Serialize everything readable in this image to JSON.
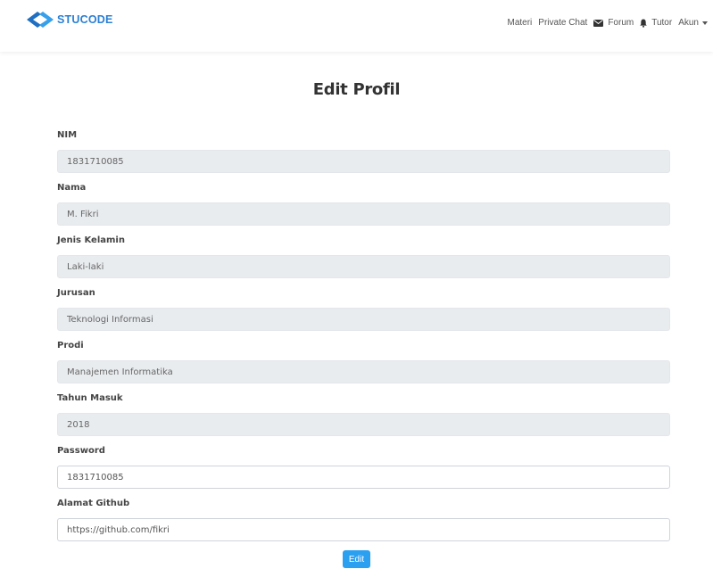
{
  "brand": {
    "name": "STUCODE",
    "color": "#2a7fd4",
    "icon": "code-brackets-icon"
  },
  "nav": {
    "items": [
      {
        "label": "Materi"
      },
      {
        "label": "Private Chat"
      },
      {
        "label": "Forum",
        "icon": "envelope-icon"
      },
      {
        "label": "Tutor",
        "icon": "bell-icon"
      },
      {
        "label": "Akun",
        "icon": "caret-down-icon"
      }
    ]
  },
  "page": {
    "title": "Edit Profil"
  },
  "form": {
    "fields": [
      {
        "label": "NIM",
        "value": "1831710085",
        "readonly": true
      },
      {
        "label": "Nama",
        "value": "M. Fikri",
        "readonly": true
      },
      {
        "label": "Jenis Kelamin",
        "value": "Laki-laki",
        "readonly": true
      },
      {
        "label": "Jurusan",
        "value": "Teknologi Informasi",
        "readonly": true
      },
      {
        "label": "Prodi",
        "value": "Manajemen Informatika",
        "readonly": true
      },
      {
        "label": "Tahun Masuk",
        "value": "2018",
        "readonly": true
      },
      {
        "label": "Password",
        "value": "1831710085",
        "readonly": false
      },
      {
        "label": "Alamat Github",
        "value": "https://github.com/fikri",
        "readonly": false
      }
    ],
    "submit_label": "Edit",
    "submit_color": "#2b9ff0",
    "readonly_bg": "#e9ecef"
  }
}
